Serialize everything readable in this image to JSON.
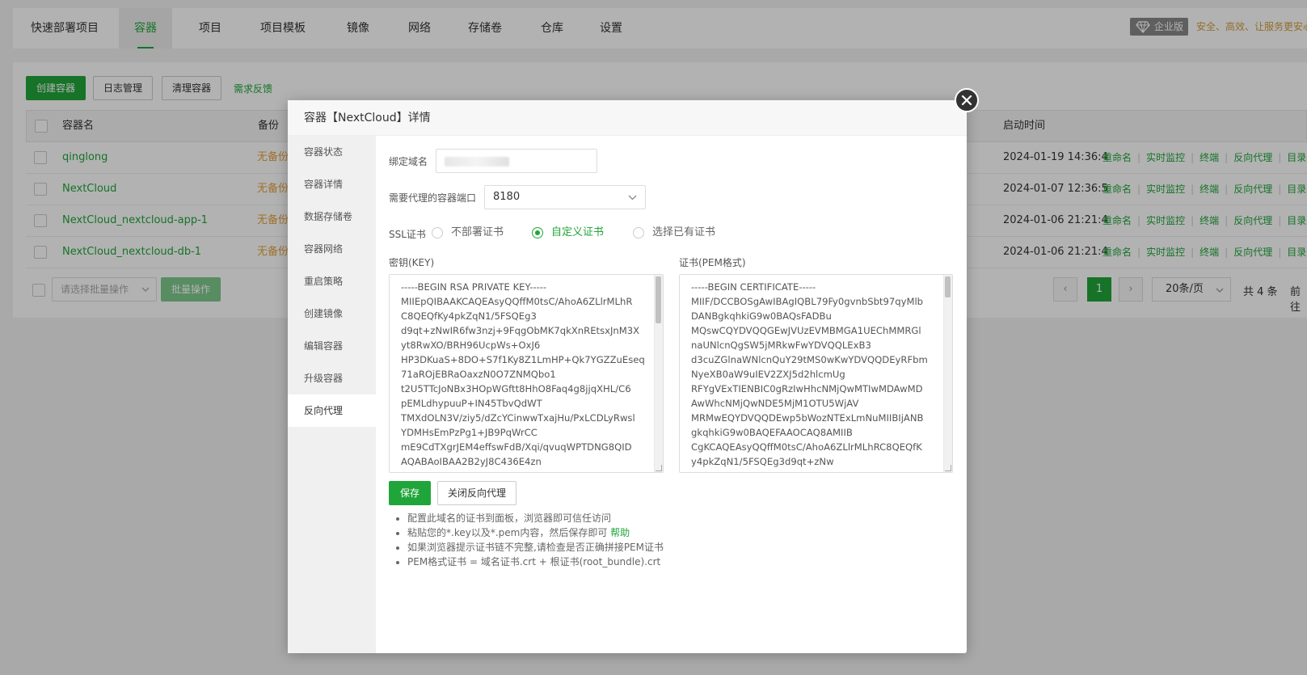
{
  "nav": {
    "tabs": [
      "快速部署项目",
      "容器",
      "项目",
      "项目模板",
      "镜像",
      "网络",
      "存储卷",
      "仓库",
      "设置"
    ],
    "active": "容器",
    "enterprise_badge": "企业版",
    "slogan": "安全、高效、让服务更安心"
  },
  "toolbar": {
    "create_button": "创建容器",
    "log_button": "日志管理",
    "clean_button": "清理容器",
    "feedback_link": "需求反馈"
  },
  "table": {
    "headers": {
      "name": "容器名",
      "backup": "备份",
      "start_time": "启动时间"
    },
    "rows": [
      {
        "name": "qinglong",
        "backup": "无备份",
        "start_time": "2024-01-19 14:36:4"
      },
      {
        "name": "NextCloud",
        "backup": "无备份",
        "start_time": "2024-01-07 12:36:5"
      },
      {
        "name": "NextCloud_nextcloud-app-1",
        "backup": "无备份",
        "start_time": "2024-01-06 21:21:4"
      },
      {
        "name": "NextCloud_nextcloud-db-1",
        "backup": "无备份",
        "start_time": "2024-01-06 21:21:4"
      }
    ],
    "row_actions": [
      "重命名",
      "实时监控",
      "终端",
      "反向代理",
      "目录"
    ]
  },
  "footer": {
    "batch_placeholder": "请选择批量操作",
    "batch_button": "批量操作",
    "current_page": "1",
    "page_size": "20条/页",
    "total": "共 4 条",
    "goto": "前往"
  },
  "modal": {
    "title": "容器【NextCloud】详情",
    "menu": [
      "容器状态",
      "容器详情",
      "数据存储卷",
      "容器网络",
      "重启策略",
      "创建镜像",
      "编辑容器",
      "升级容器",
      "反向代理"
    ],
    "active_menu": "反向代理",
    "domain_label": "绑定域名",
    "port_label": "需要代理的容器端口",
    "port_value": "8180",
    "ssl_label": "SSL证书",
    "ssl_options": [
      "不部署证书",
      "自定义证书",
      "选择已有证书"
    ],
    "ssl_selected": "自定义证书",
    "key_label": "密钥(KEY)",
    "key_text": "-----BEGIN RSA PRIVATE KEY-----\nMIIEpQIBAAKCAQEAsyQQffM0tsC/AhoA6ZLlrMLhR\nC8QEQfKy4pkZqN1/5FSQEg3\nd9qt+zNwIR6fw3nzj+9FqgObMK7qkXnREtsxJnM3X\nyt8RwXO/BRH96UcpWs+OxJ6\nHP3DKuaS+8DO+S7f1Ky8Z1LmHP+Qk7YGZZuEseq\n71aROjEBRaOaxzN0O7ZNMQbo1\nt2U5TTcJoNBx3HOpWGftt8HhO8Faq4g8jjqXHL/C6\npEMLdhypuuP+IN45TbvQdWT\nTMXdOLN3V/ziy5/dZcYCinwwTxajHu/PxLCDLyRwsl\nYDMHsEmPzPg1+JB9PqWrCC\nmE9CdTXgrJEM4effswFdB/Xqi/qvuqWPTDNG8QID\nAQABAoIBAA2B2yJ8C436E4zn",
    "cert_label": "证书(PEM格式)",
    "cert_text": "-----BEGIN CERTIFICATE-----\nMIIF/DCCBOSgAwIBAgIQBL79Fy0gvnbSbt97qyMlb\nDANBgkqhkiG9w0BAQsFADBu\nMQswCQYDVQQGEwJVUzEVMBMGA1UEChMMRGl\nnaUNlcnQgSW5jMRkwFwYDVQQLExB3\nd3cuZGlnaWNlcnQuY29tMS0wKwYDVQQDEyRFbm\nNyeXB0aW9uIEV2ZXJ5d2hlcmUg\nRFYgVExTIENBIC0gRzIwHhcNMjQwMTIwMDAwMD\nAwWhcNMjQwNDE5MjM1OTU5WjAV\nMRMwEQYDVQQDEwp5bWozNTExLmNuMIIBIjANB\ngkqhkiG9w0BAQEFAAOCAQ8AMIIB\nCgKCAQEAsyQQffM0tsC/AhoA6ZLlrMLhRC8QEQfK\ny4pkZqN1/5FSQEg3d9qt+zNw",
    "save_button": "保存",
    "close_proxy_button": "关闭反向代理",
    "tips": [
      "配置此域名的证书到面板，浏览器即可信任访问",
      "粘贴您的*.key以及*.pem内容，然后保存即可",
      "如果浏览器提示证书链不完整,请检查是否正确拼接PEM证书",
      "PEM格式证书 = 域名证书.crt + 根证书(root_bundle).crt"
    ],
    "help_link": "帮助"
  },
  "colors": {
    "accent": "#20a53a",
    "warning": "#e6a23c",
    "overlay": "rgba(0,0,0,0.30)"
  },
  "icons": {
    "close": "close-icon",
    "diamond": "diamond-icon",
    "chevron": "chevron-down-icon"
  }
}
